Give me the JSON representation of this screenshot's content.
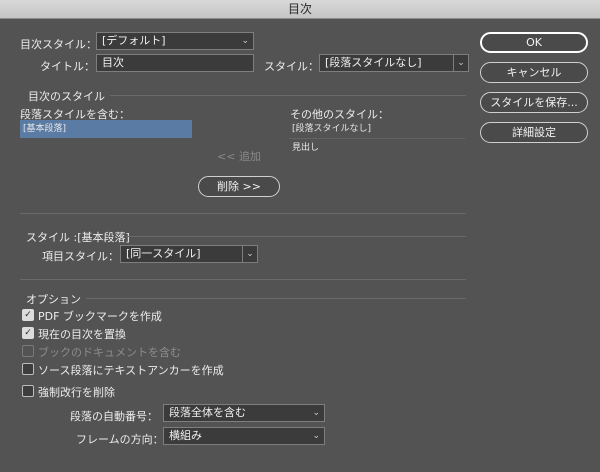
{
  "window": {
    "title": "目次"
  },
  "top": {
    "toc_style_label": "目次スタイル：",
    "toc_style_value": "[デフォルト]",
    "title_label": "タイトル：",
    "title_value": "目次",
    "style_label": "スタイル：",
    "style_value": "[段落スタイルなし]"
  },
  "buttons": {
    "ok": "OK",
    "cancel": "キャンセル",
    "save_style": "スタイルを保存...",
    "more_options": "詳細設定"
  },
  "toc_styles_section": {
    "heading": "目次のスタイル",
    "include_label": "段落スタイルを含む：",
    "include_items": [
      "[基本段落]"
    ],
    "other_label": "その他のスタイル：",
    "other_items": [
      "[段落スタイルなし]",
      "見出し"
    ],
    "add_button": "<< 追加",
    "remove_button": "削除 >>"
  },
  "style_section": {
    "heading": "スタイル :[基本段落]",
    "entry_style_label": "項目スタイル：",
    "entry_style_value": "[同一スタイル]"
  },
  "options": {
    "heading": "オプション",
    "pdf_bookmarks": {
      "label": "PDF ブックマークを作成",
      "checked": true
    },
    "replace_toc": {
      "label": "現在の目次を置換",
      "checked": true
    },
    "include_book": {
      "label": "ブックのドキュメントを含む",
      "checked": false,
      "disabled": true
    },
    "text_anchors": {
      "label": "ソース段落にテキストアンカーを作成",
      "checked": false
    },
    "remove_breaks": {
      "label": "強制改行を削除",
      "checked": false
    },
    "numbered_label": "段落の自動番号：",
    "numbered_value": "段落全体を含む",
    "frame_dir_label": "フレームの方向：",
    "frame_dir_value": "横組み"
  }
}
